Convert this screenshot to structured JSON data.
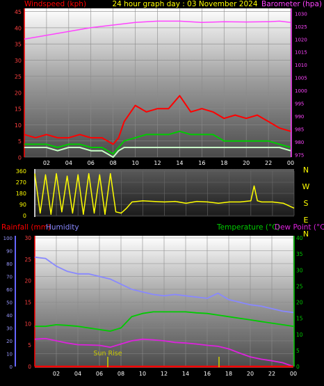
{
  "chart_data": [
    {
      "type": "line",
      "title": "24 hour graph day : 03 November 2024",
      "ylabel_left": "Windspeed (kph)",
      "ylabel_right": "Barometer (hpa)",
      "x_ticks": [
        "02",
        "04",
        "06",
        "08",
        "10",
        "12",
        "14",
        "16",
        "18",
        "20",
        "22",
        "00"
      ],
      "y_ticks_left": [
        "0",
        "5",
        "10",
        "15",
        "20",
        "25",
        "30",
        "35",
        "40",
        "45"
      ],
      "y_ticks_right": [
        "975",
        "980",
        "985",
        "990",
        "995",
        "1000",
        "1005",
        "1010",
        "1015",
        "1020",
        "1025",
        "1030"
      ],
      "ylim_left": [
        0,
        46
      ],
      "ylim_right": [
        974,
        1032
      ],
      "series": [
        {
          "name": "Windspeed (kph)",
          "color": "#ff0000",
          "x": [
            0,
            1,
            2,
            3,
            4,
            5,
            6,
            7,
            7.5,
            8,
            8.5,
            9,
            10,
            11,
            12,
            13,
            14,
            15,
            16,
            17,
            18,
            19,
            20,
            21,
            22,
            23,
            24
          ],
          "y": [
            7,
            6,
            7,
            6,
            6,
            7,
            6,
            6,
            5,
            4,
            6,
            11,
            16,
            14,
            15,
            15,
            19,
            14,
            15,
            14,
            12,
            13,
            12,
            13,
            11,
            9,
            8
          ]
        },
        {
          "color": "#00cc00",
          "x": [
            0,
            1,
            2,
            3,
            4,
            5,
            6,
            7,
            7.5,
            8,
            8.5,
            9,
            10,
            11,
            12,
            13,
            14,
            15,
            16,
            17,
            18,
            19,
            20,
            21,
            22,
            23,
            24
          ],
          "y": [
            4,
            4,
            4,
            3,
            4,
            4,
            3,
            3,
            2,
            1,
            3,
            5,
            6,
            7,
            7,
            7,
            8,
            7,
            7,
            7,
            5,
            5,
            5,
            5,
            5,
            4,
            3
          ]
        },
        {
          "color": "#c8ffc8",
          "x": [
            0,
            1,
            2,
            3,
            4,
            5,
            6,
            7,
            7.5,
            8,
            8.5,
            9,
            10,
            11,
            12,
            13,
            14,
            15,
            16,
            17,
            18,
            19,
            20,
            21,
            22,
            23,
            24
          ],
          "y": [
            3,
            3,
            3,
            2,
            3,
            3,
            2,
            2,
            1,
            0,
            2,
            3,
            3,
            3,
            3,
            3,
            3,
            3,
            3,
            3,
            3,
            3,
            3,
            3,
            3,
            3,
            2
          ]
        },
        {
          "name": "Barometer (hpa)",
          "color": "#ff44ff",
          "axis": "right",
          "x": [
            0,
            2,
            4,
            6,
            8,
            10,
            12,
            14,
            16,
            18,
            20,
            22,
            23,
            24
          ],
          "y": [
            1020,
            1021.5,
            1023,
            1024.5,
            1025.5,
            1026.5,
            1027,
            1027,
            1026.5,
            1026.8,
            1026.7,
            1026.8,
            1027,
            1026.5
          ]
        }
      ]
    },
    {
      "type": "line",
      "y_ticks_left": [
        "0",
        "90",
        "180",
        "270",
        "360"
      ],
      "y_ticks_right": [
        "N",
        "W",
        "S",
        "E",
        "N"
      ],
      "ylim": [
        0,
        360
      ],
      "series": [
        {
          "color": "#ffff00",
          "x": [
            0,
            0.5,
            1,
            1.5,
            2,
            2.5,
            3,
            3.5,
            4,
            4.5,
            5,
            5.5,
            6,
            6.5,
            7,
            7.5,
            8,
            8.5,
            9,
            10,
            11,
            12,
            13,
            14,
            15,
            16,
            17,
            18,
            19,
            20,
            20.3,
            20.6,
            21,
            22,
            23,
            24
          ],
          "y": [
            340,
            20,
            330,
            10,
            340,
            30,
            320,
            20,
            330,
            10,
            340,
            20,
            330,
            10,
            340,
            30,
            20,
            60,
            110,
            120,
            115,
            110,
            115,
            100,
            115,
            110,
            100,
            110,
            110,
            120,
            240,
            120,
            110,
            110,
            100,
            60
          ]
        }
      ]
    },
    {
      "type": "line",
      "ylabel_left_1": "Rainfall (mm)",
      "ylabel_left_2": "Humidity",
      "ylabel_right_1": "Temperature (°C)",
      "ylabel_right_2": "Dew Point (°C)",
      "x_ticks": [
        "02",
        "04",
        "06",
        "08",
        "10",
        "12",
        "14",
        "16",
        "18",
        "20",
        "22",
        "00"
      ],
      "humidity_ticks": [
        "0",
        "10",
        "20",
        "30",
        "40",
        "50",
        "60",
        "70",
        "80",
        "90",
        "100"
      ],
      "rain_ticks": [
        "0",
        "5",
        "10",
        "15",
        "20",
        "25",
        "30"
      ],
      "temp_ticks": [
        "0",
        "5",
        "10",
        "15",
        "20",
        "25",
        "30",
        "35",
        "40"
      ],
      "annotation": "Sun Rise",
      "series": [
        {
          "name": "Humidity",
          "color": "#8888ff",
          "axis": "humidity",
          "x": [
            0,
            1,
            2,
            3,
            4,
            5,
            6,
            7,
            8,
            9,
            10,
            11,
            12,
            13,
            14,
            15,
            16,
            17,
            18,
            19,
            20,
            21,
            22,
            23,
            24
          ],
          "y": [
            85,
            84,
            78,
            74,
            72,
            72,
            70,
            68,
            64,
            60,
            58,
            56,
            55,
            56,
            55,
            54,
            53,
            57,
            52,
            50,
            48,
            47,
            45,
            43,
            42
          ]
        },
        {
          "name": "Temperature (°C)",
          "color": "#00cc00",
          "axis": "temp",
          "x": [
            0,
            1,
            2,
            3,
            4,
            5,
            6,
            7,
            8,
            9,
            10,
            11,
            12,
            13,
            14,
            15,
            16,
            17,
            18,
            19,
            20,
            21,
            22,
            23,
            24
          ],
          "y": [
            12.5,
            12.5,
            13,
            12.8,
            12.5,
            12,
            11.5,
            11,
            12,
            15.5,
            16.5,
            17,
            17,
            17,
            17,
            16.7,
            16.5,
            16,
            15.5,
            15,
            14.5,
            14,
            13.5,
            13,
            12.5
          ]
        },
        {
          "name": "Dew Point (°C)",
          "color": "#dd22dd",
          "axis": "temp",
          "x": [
            0,
            1,
            2,
            3,
            4,
            5,
            6,
            7,
            8,
            9,
            10,
            11,
            12,
            13,
            14,
            15,
            16,
            17,
            18,
            19,
            20,
            21,
            22,
            23,
            24
          ],
          "y": [
            8.5,
            8.7,
            8,
            7.3,
            6.8,
            6.7,
            6.6,
            6,
            7,
            8,
            8.5,
            8.3,
            8,
            7.5,
            7.3,
            7,
            6.6,
            6.3,
            5.5,
            4.2,
            3,
            2.3,
            1.8,
            1.2,
            0
          ]
        },
        {
          "name": "Rainfall (mm)",
          "color": "#ff0000",
          "axis": "rain",
          "x": [
            0,
            24
          ],
          "y": [
            0,
            0
          ]
        }
      ]
    }
  ]
}
